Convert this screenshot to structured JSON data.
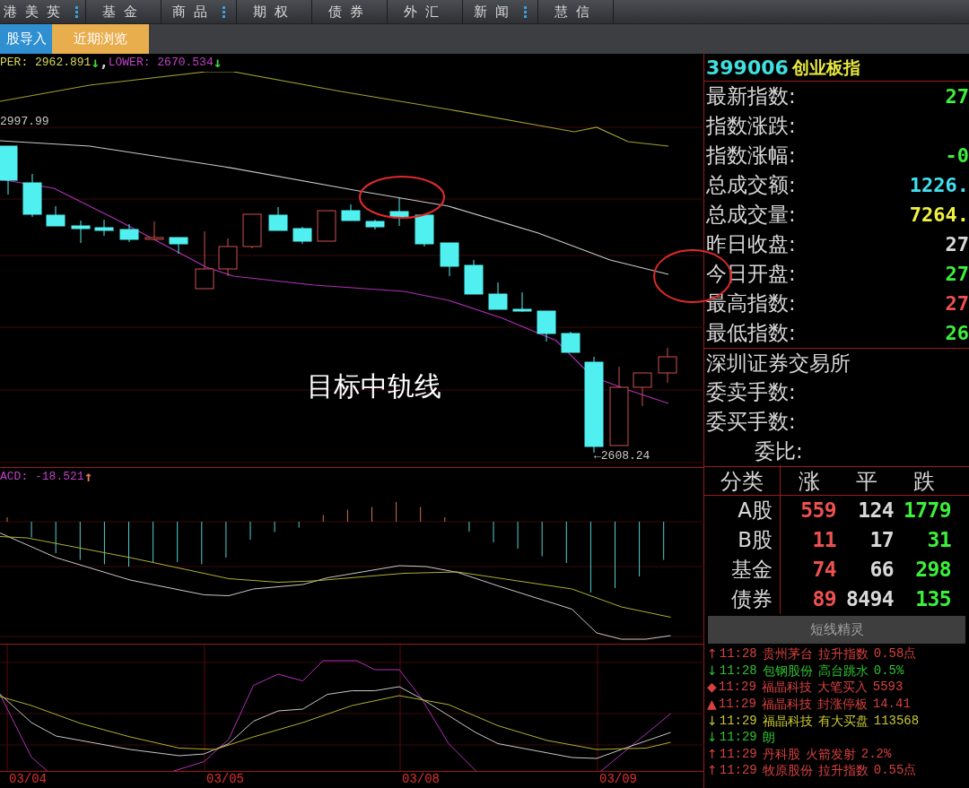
{
  "nav_tabs": [
    {
      "label": "港美英",
      "has_menu": true
    },
    {
      "label": "基金",
      "has_menu": false
    },
    {
      "label": "商品",
      "has_menu": true
    },
    {
      "label": "期权",
      "has_menu": false
    },
    {
      "label": "债券",
      "has_menu": false
    },
    {
      "label": "外汇",
      "has_menu": false
    },
    {
      "label": "新闻",
      "has_menu": true
    },
    {
      "label": "慧信",
      "has_menu": false
    }
  ],
  "sub_tabs": [
    {
      "label": "股导入",
      "color": "#2f8fd0"
    },
    {
      "label": "近期浏览",
      "color": "#e8ad4c"
    }
  ],
  "main_chart": {
    "legend": [
      {
        "text": "PER: 2962.891",
        "color": "#d8d85a"
      },
      {
        "text": "↓",
        "color": "#3cd63c"
      },
      {
        "text": ",",
        "color": "#d8d8d8"
      },
      {
        "text": "LOWER: 2670.534",
        "color": "#c040c8"
      },
      {
        "text": "↓",
        "color": "#3cd63c"
      }
    ],
    "high_label": "2997.99",
    "low_label": "←2608.24",
    "annotation": "目标中轨线"
  },
  "macd": {
    "legend": [
      {
        "text": "ACD: -18.521",
        "color": "#c040c8"
      },
      {
        "text": "↑",
        "color": "#e8804a"
      }
    ]
  },
  "dates": [
    "03/04",
    "03/05",
    "03/08",
    "03/09"
  ],
  "quote": {
    "code": "399006",
    "name": "创业板指",
    "rows": [
      {
        "label": "最新指数:",
        "value": "27",
        "color": "#3cf03c"
      },
      {
        "label": "指数涨跌:"
      },
      {
        "label": "指数涨幅:",
        "value": "-0",
        "color": "#3cf03c"
      },
      {
        "label": "总成交额:",
        "value": "1226.",
        "color": "#40e0f0"
      },
      {
        "label": "总成交量:",
        "value": "7264.",
        "color": "#f0f040"
      },
      {
        "label": "昨日收盘:",
        "value": "27",
        "color": "#d8d8d8"
      },
      {
        "label": "今日开盘:",
        "value": "27",
        "color": "#3cf03c"
      },
      {
        "label": "最高指数:",
        "value": "27",
        "color": "#f05050"
      },
      {
        "label": "最低指数:",
        "value": "26",
        "color": "#3cf03c"
      }
    ],
    "exchange": "深圳证券交易所",
    "order_rows": [
      "委卖手数:",
      "委买手数:",
      "委比:"
    ]
  },
  "breadth": {
    "columns": [
      "分类",
      "涨",
      "平",
      "跌"
    ],
    "rows": [
      {
        "cells": [
          "A股",
          "559",
          "124",
          "1779"
        ]
      },
      {
        "cells": [
          "B股",
          "11",
          "17",
          "31"
        ]
      },
      {
        "cells": [
          "基金",
          "74",
          "66",
          "298"
        ]
      },
      {
        "cells": [
          "债券",
          "89",
          "8494",
          "135"
        ]
      }
    ]
  },
  "alerts": {
    "title": "短线精灵",
    "items": [
      {
        "symbol": "↑",
        "time": "11:28",
        "name": "贵州茅台",
        "event": "拉升指数",
        "value": "0.58点",
        "color": "#d84040"
      },
      {
        "symbol": "↓",
        "time": "11:28",
        "name": "包钢股份",
        "event": "高台跳水",
        "value": "0.5%",
        "color": "#30c030"
      },
      {
        "symbol": "◆",
        "time": "11:29",
        "name": "福晶科技",
        "event": "大笔买入",
        "value": "5593",
        "color": "#d84040"
      },
      {
        "symbol": "▲",
        "time": "11:29",
        "name": "福晶科技",
        "event": "封涨停板",
        "value": "14.41",
        "color": "#d84040"
      },
      {
        "symbol": "↓",
        "time": "11:29",
        "name": "福晶科技",
        "event": "有大买盘",
        "value": "113568",
        "color": "#c8c830"
      },
      {
        "symbol": "↓",
        "time": "11:29",
        "name": "朗",
        "color": "#30c030"
      },
      {
        "symbol": "↑",
        "time": "11:29",
        "name": "丹科股",
        "event": "火箭发射",
        "value": "2.2%",
        "color": "#d84040"
      },
      {
        "symbol": "↑",
        "time": "11:29",
        "name": "牧原股份",
        "event": "拉升指数",
        "value": "0.55点",
        "color": "#d84040"
      }
    ]
  }
}
